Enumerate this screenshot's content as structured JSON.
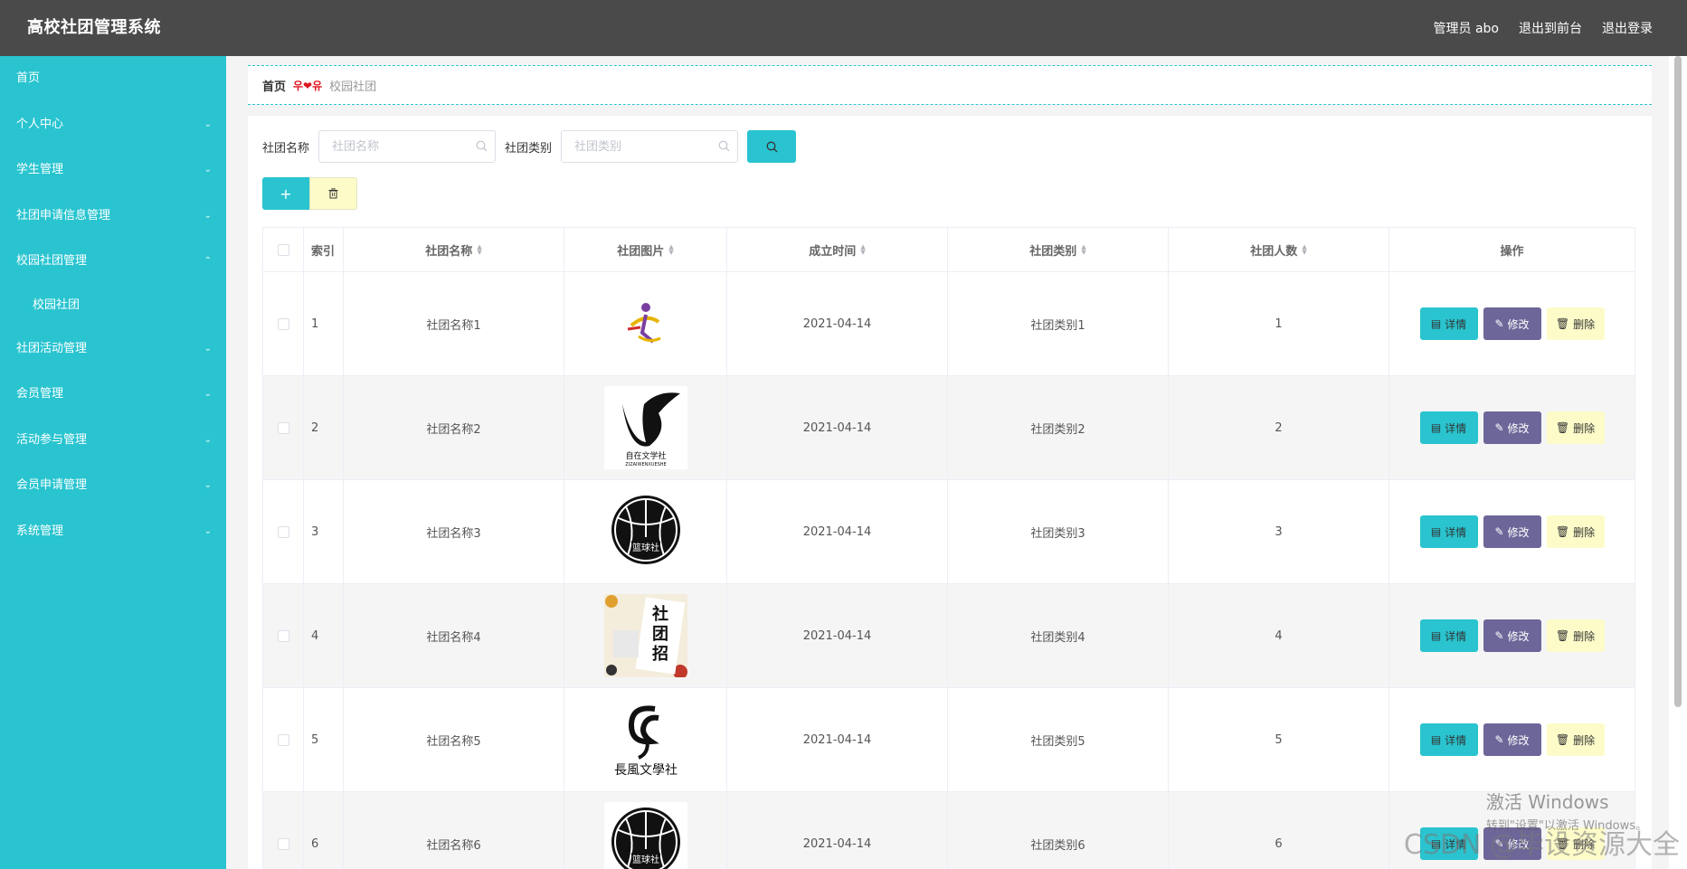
{
  "header": {
    "app_title": "高校社团管理系统",
    "user_label": "管理员 abo",
    "to_front": "退出到前台",
    "logout": "退出登录"
  },
  "sidebar": {
    "items": [
      {
        "label": "首页",
        "has_arrow": false
      },
      {
        "label": "个人中心",
        "has_arrow": true
      },
      {
        "label": "学生管理",
        "has_arrow": true
      },
      {
        "label": "社团申请信息管理",
        "has_arrow": true
      },
      {
        "label": "校园社团管理",
        "has_arrow": true,
        "expanded": true
      },
      {
        "label": "社团活动管理",
        "has_arrow": true
      },
      {
        "label": "会员管理",
        "has_arrow": true
      },
      {
        "label": "活动参与管理",
        "has_arrow": true
      },
      {
        "label": "会员申请管理",
        "has_arrow": true
      },
      {
        "label": "系统管理",
        "has_arrow": true
      }
    ],
    "sub_item": "校园社团"
  },
  "breadcrumb": {
    "home": "首页",
    "separator": "우❤유",
    "current": "校园社团"
  },
  "search": {
    "name_label": "社团名称",
    "name_placeholder": "社团名称",
    "type_label": "社团类别",
    "type_placeholder": "社团类别"
  },
  "table": {
    "headers": {
      "index": "索引",
      "name": "社团名称",
      "image": "社团图片",
      "date": "成立时间",
      "type": "社团类别",
      "count": "社团人数",
      "ops": "操作"
    },
    "rows": [
      {
        "index": "1",
        "name": "社团名称1",
        "image": "logo-dancer",
        "date": "2021-04-14",
        "type": "社团类别1",
        "count": "1"
      },
      {
        "index": "2",
        "name": "社团名称2",
        "image": "logo-literature",
        "date": "2021-04-14",
        "type": "社团类别2",
        "count": "2"
      },
      {
        "index": "3",
        "name": "社团名称3",
        "image": "logo-basketball",
        "date": "2021-04-14",
        "type": "社团类别3",
        "count": "3"
      },
      {
        "index": "4",
        "name": "社团名称4",
        "image": "logo-recruit-poster",
        "date": "2021-04-14",
        "type": "社团类别4",
        "count": "4"
      },
      {
        "index": "5",
        "name": "社团名称5",
        "image": "logo-calligraphy",
        "date": "2021-04-14",
        "type": "社团类别5",
        "count": "5"
      },
      {
        "index": "6",
        "name": "社团名称6",
        "image": "logo-basketball",
        "date": "2021-04-14",
        "type": "社团类别6",
        "count": "6"
      }
    ],
    "op_labels": {
      "detail": "详情",
      "edit": "修改",
      "remove": "删除"
    }
  },
  "overlay": {
    "activate_title": "激活 Windows",
    "activate_sub": "转到\"设置\"以激活 Windows。",
    "csdn": "CSDN @毕设资源大全"
  },
  "colors": {
    "accent": "#29c4d0",
    "topbar": "#4a4a4a",
    "edit_button": "#6d6799",
    "delete_button": "#fdfcc9"
  }
}
